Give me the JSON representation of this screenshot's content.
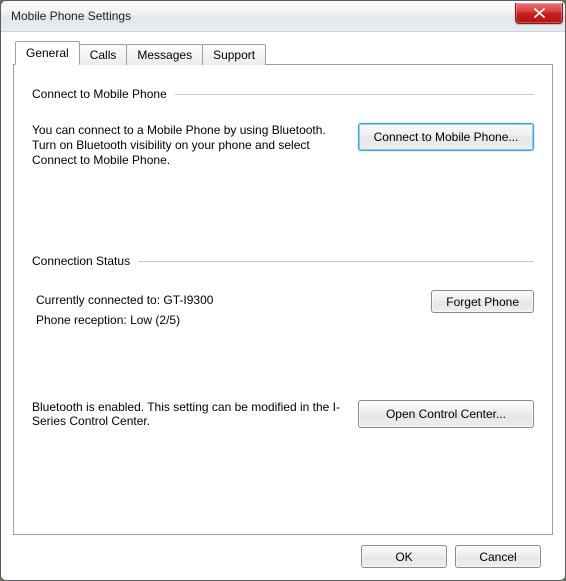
{
  "window": {
    "title": "Mobile Phone Settings"
  },
  "tabs": {
    "general": "General",
    "calls": "Calls",
    "messages": "Messages",
    "support": "Support"
  },
  "connect": {
    "heading": "Connect to Mobile Phone",
    "desc": "You can connect to a Mobile Phone by using Bluetooth. Turn on Bluetooth visibility on your phone and select Connect to Mobile Phone.",
    "button": "Connect to Mobile Phone..."
  },
  "status": {
    "heading": "Connection Status",
    "line1": "Currently connected to: GT-I9300",
    "line2": "Phone reception: Low (2/5)",
    "forget": "Forget Phone"
  },
  "bluetooth": {
    "desc": "Bluetooth is enabled. This setting can be modified in the I-Series Control Center.",
    "button": "Open Control Center..."
  },
  "dialog": {
    "ok": "OK",
    "cancel": "Cancel"
  }
}
